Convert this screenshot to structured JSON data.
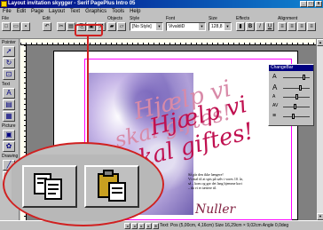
{
  "window": {
    "title": "Layout invitation skygger - Serif PagePlus Intro 05",
    "controls": [
      "_",
      "□",
      "x"
    ]
  },
  "menu": [
    "File",
    "Edit",
    "Page",
    "Layout",
    "Text",
    "Graphics",
    "Tools",
    "Help"
  ],
  "toolbar": {
    "groups": {
      "file": "File",
      "edit": "Edit",
      "objects": "Objects",
      "style": "Style",
      "font": "Font",
      "size": "Size",
      "effects": "Effects",
      "alignment": "Alignment"
    },
    "style_value": "[No Style]",
    "font_value": "VivaldiD",
    "size_value": "128,8",
    "effect_labels": {
      "bold": "B",
      "italic": "I",
      "underline": "U"
    }
  },
  "left_toolbar": {
    "labels": {
      "pointer": "Pointer",
      "text": "Text",
      "picture": "Picture",
      "drawing": "Drawing"
    }
  },
  "document": {
    "headline_back": "Hjælp vi",
    "headline_back2": "skal giftes!",
    "headline_front": "Hjælp vi",
    "headline_front2": "skal giftes!",
    "body_lines": [
      "Så går den ikke længere!",
      "Vi skal til at spis på sølv i vores 10. år,",
      "så – kom og gør det lang hjemme kort",
      "– da vi er tættere til."
    ],
    "signature": "Nuller"
  },
  "changefile_panel": {
    "title": "ChangeBar",
    "rows": [
      "A",
      "A",
      "A",
      "AV",
      "≡"
    ]
  },
  "statusbar": {
    "text": "Text: Pos (5,00cm, 4,16cm) Size 16,29cm × 9,02cm Angle 0,0deg"
  },
  "magnifier": {
    "zoomed_buttons": [
      "copy-button",
      "paste-button"
    ]
  },
  "colors": {
    "titlebar": "#000080",
    "headline": "#c01050",
    "callout": "#d02020"
  }
}
